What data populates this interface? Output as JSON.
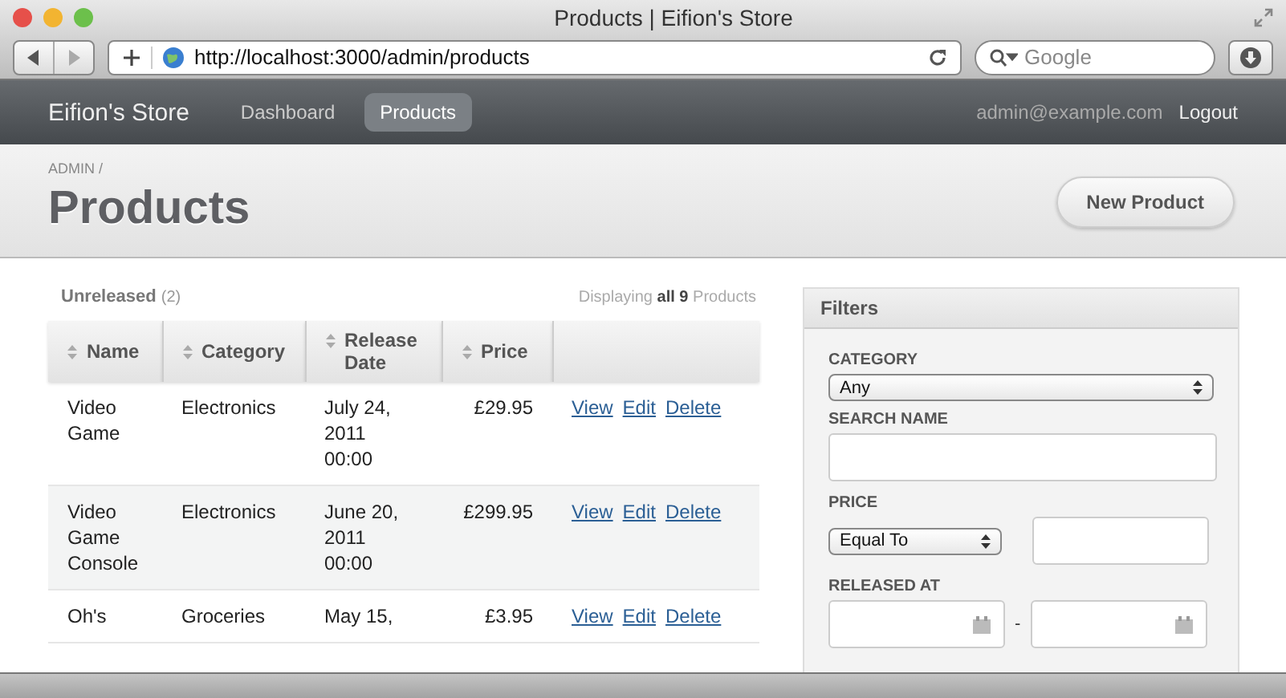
{
  "browser": {
    "title": "Products | Eifion's Store",
    "url": "http://localhost:3000/admin/products",
    "search_placeholder": "Google"
  },
  "nav": {
    "brand": "Eifion's Store",
    "items": [
      {
        "label": "Dashboard",
        "selected": false
      },
      {
        "label": "Products",
        "selected": true
      }
    ],
    "user": "admin@example.com",
    "logout": "Logout"
  },
  "header": {
    "breadcrumb": "ADMIN /",
    "title": "Products",
    "new_button": "New Product"
  },
  "scope": {
    "label": "Unreleased",
    "count": "(2)"
  },
  "displaying": "Displaying **all 9** Products",
  "table": {
    "columns": [
      {
        "label": "Name",
        "sortable": true
      },
      {
        "label": "Category",
        "sortable": true
      },
      {
        "label": "Release Date",
        "sortable": true
      },
      {
        "label": "Price",
        "sortable": true
      }
    ],
    "rows": [
      {
        "name": "Video Game",
        "category": "Electronics",
        "release_date": "July 24, 2011 00:00",
        "price": "£29.95",
        "actions": [
          "View",
          "Edit",
          "Delete"
        ]
      },
      {
        "name": "Video Game Console",
        "category": "Electronics",
        "release_date": "June 20, 2011 00:00",
        "price": "£299.95",
        "actions": [
          "View",
          "Edit",
          "Delete"
        ]
      },
      {
        "name": "Oh's",
        "category": "Groceries",
        "release_date": "May 15,",
        "price": "£3.95",
        "actions": [
          "View",
          "Edit",
          "Delete"
        ]
      }
    ]
  },
  "filters": {
    "title": "Filters",
    "category": {
      "label": "CATEGORY",
      "value": "Any"
    },
    "search_name": {
      "label": "SEARCH NAME"
    },
    "price": {
      "label": "PRICE",
      "operator": "Equal To"
    },
    "released_at": {
      "label": "RELEASED AT",
      "separator": "-"
    }
  }
}
